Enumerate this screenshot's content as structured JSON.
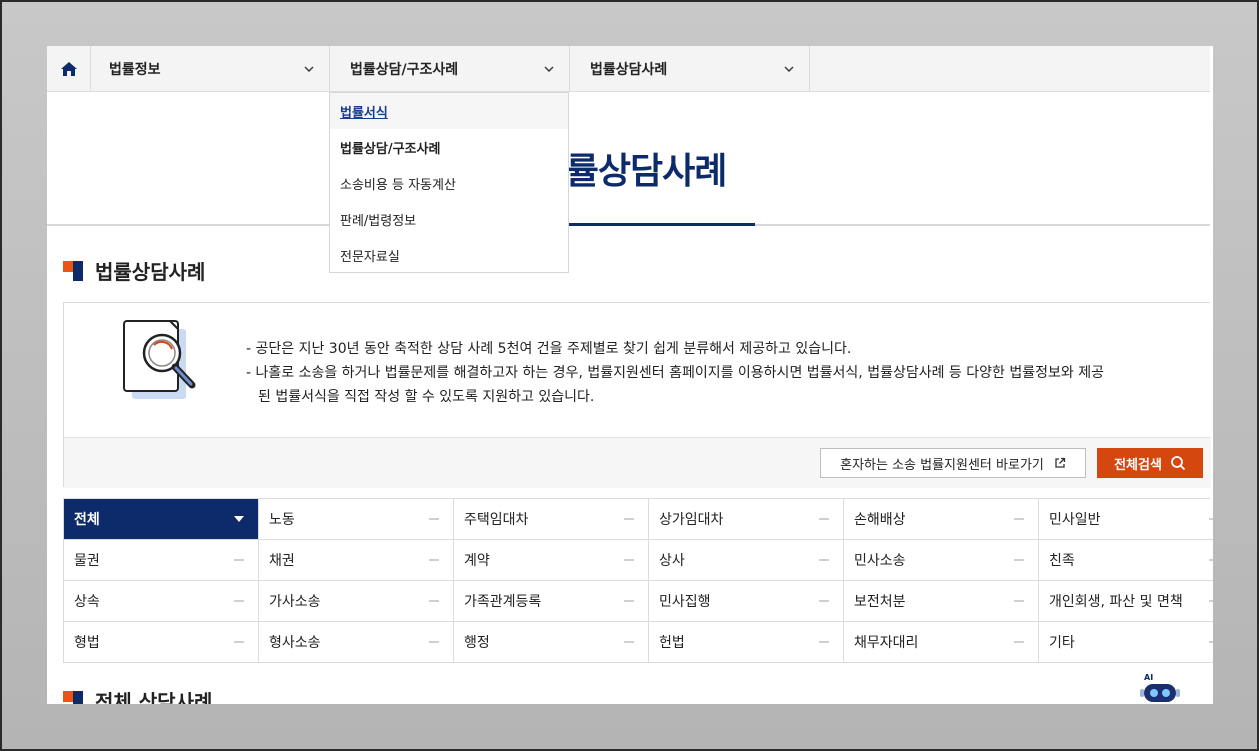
{
  "nav": {
    "home_icon": "home-icon",
    "items": [
      {
        "label": "법률정보"
      },
      {
        "label": "법률상담/구조사례"
      },
      {
        "label": "법률상담사례"
      }
    ]
  },
  "dropdown": {
    "items": [
      {
        "label": "법률서식"
      },
      {
        "label": "법률상담/구조사례"
      },
      {
        "label": "소송비용 등 자동계산"
      },
      {
        "label": "판례/법령정보"
      },
      {
        "label": "전문자료실"
      }
    ]
  },
  "page_title": "법률상담사례",
  "section1": {
    "title": "법률상담사례"
  },
  "info": {
    "line1": "- 공단은 지난 30년 동안 축적한 상담 사례 5천여 건을 주제별로 찾기 쉽게 분류해서 제공하고 있습니다.",
    "line2": "- 나홀로 소송을 하거나 법률문제를 해결하고자 하는 경우, 법률지원센터 홈페이지를 이용하시면 법률서식, 법률상담사례 등 다양한 법률정보와 제공",
    "line3": "된 법률서식을 직접 작성 할 수 있도록 지원하고 있습니다.",
    "link_button": "혼자하는 소송 법률지원센터 바로가기",
    "search_button": "전체검색"
  },
  "categories": [
    {
      "label": "전체"
    },
    {
      "label": "노동"
    },
    {
      "label": "주택임대차"
    },
    {
      "label": "상가임대차"
    },
    {
      "label": "손해배상"
    },
    {
      "label": "민사일반"
    },
    {
      "label": "물권"
    },
    {
      "label": "채권"
    },
    {
      "label": "계약"
    },
    {
      "label": "상사"
    },
    {
      "label": "민사소송"
    },
    {
      "label": "친족"
    },
    {
      "label": "상속"
    },
    {
      "label": "가사소송"
    },
    {
      "label": "가족관계등록"
    },
    {
      "label": "민사집행"
    },
    {
      "label": "보전처분"
    },
    {
      "label": "개인회생, 파산 및 면책"
    },
    {
      "label": "형법"
    },
    {
      "label": "형사소송"
    },
    {
      "label": "행정"
    },
    {
      "label": "헌법"
    },
    {
      "label": "채무자대리"
    },
    {
      "label": "기타"
    }
  ],
  "section2": {
    "title": "전체 상담사례"
  },
  "chatbot": {
    "label": "AI"
  },
  "colors": {
    "navy": "#0d2b6b",
    "accent_orange": "#d4470f"
  }
}
